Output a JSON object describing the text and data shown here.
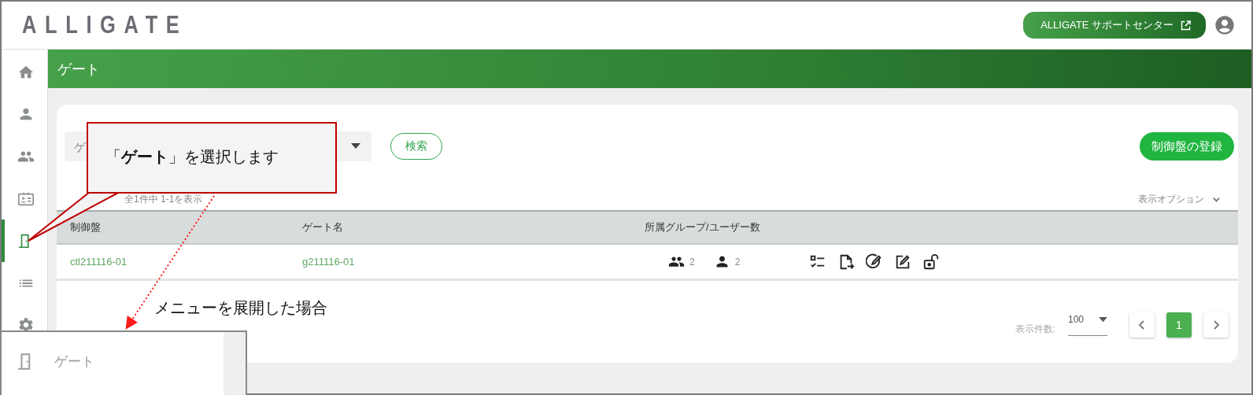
{
  "header": {
    "logo": "ALLIGATE",
    "support_button": "ALLIGATE サポートセンター"
  },
  "sidebar": {
    "items": [
      {
        "kind": "home",
        "selected": false
      },
      {
        "kind": "person",
        "selected": false
      },
      {
        "kind": "group",
        "selected": false
      },
      {
        "kind": "id-card",
        "selected": false
      },
      {
        "kind": "door",
        "selected": true
      },
      {
        "kind": "list",
        "selected": false
      },
      {
        "kind": "gear",
        "selected": false
      }
    ]
  },
  "page_title": "ゲート",
  "search": {
    "placeholder": "ゲ",
    "button": "検索"
  },
  "register_button": "制御盤の登録",
  "count_text": "全1件中 1-1を表示",
  "display_options": "表示オプション",
  "table": {
    "columns": [
      "制御盤",
      "ゲート名",
      "所属グループ/ユーザー数"
    ],
    "rows": [
      {
        "controller": "ctl211116-01",
        "gate": "g211116-01",
        "groups": "2",
        "users": "2"
      }
    ]
  },
  "pagination": {
    "per_page_label": "表示件数:",
    "per_page": "100",
    "pages": [
      {
        "label": "1",
        "selected": true
      }
    ]
  },
  "annotation": {
    "callout": "「**ゲート**」を選択します",
    "note": "メニューを展開した場合",
    "expanded_menu": {
      "items": [
        {
          "label": "ゲート"
        }
      ]
    }
  }
}
